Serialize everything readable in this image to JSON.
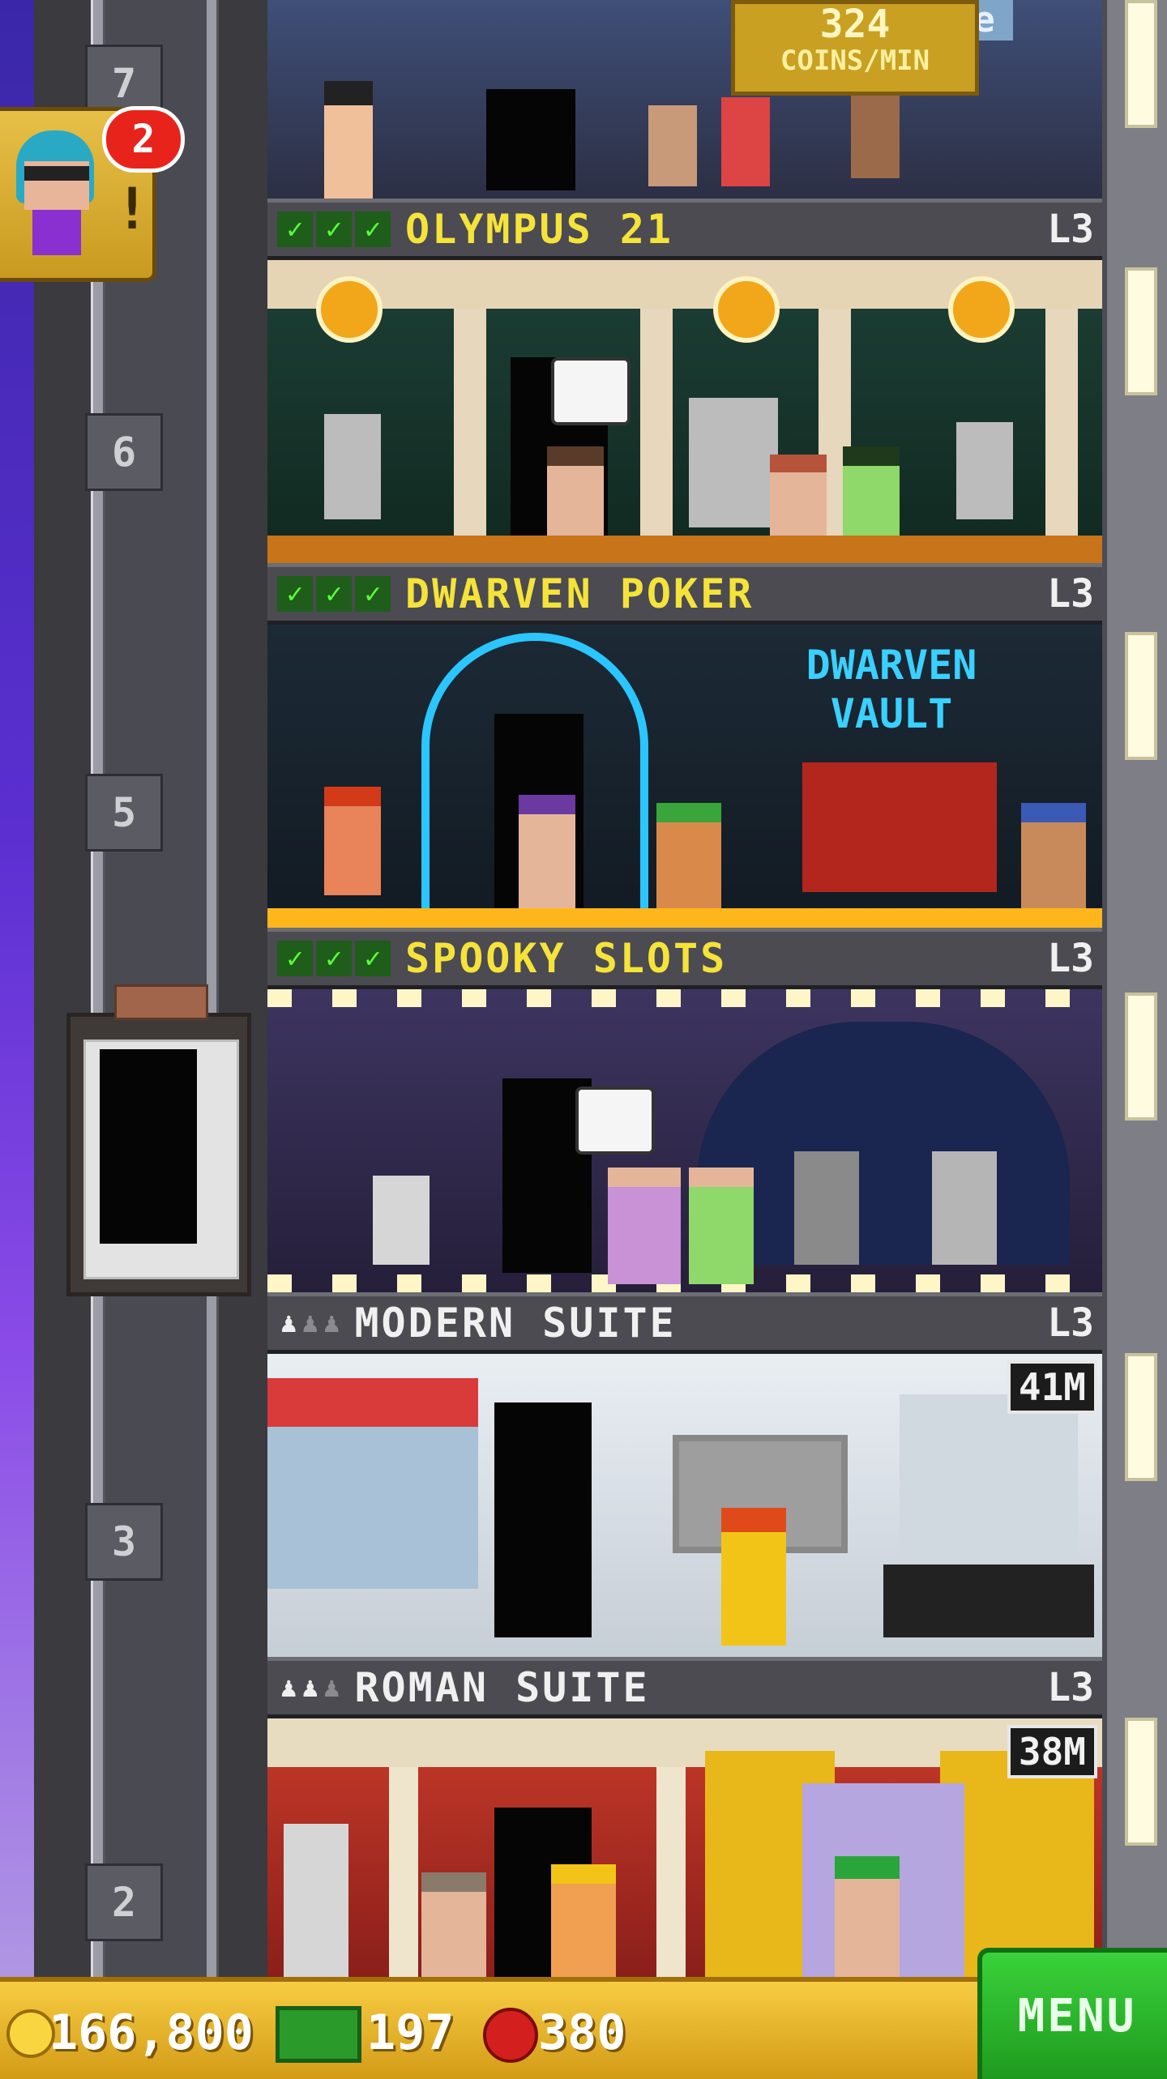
{
  "top_sign": {
    "rate": "324",
    "unit": "COINS/MIN",
    "restaurant_word": "Cuisine"
  },
  "notification": {
    "count": "2"
  },
  "floors": [
    {
      "kind": "business",
      "name": "OLYMPUS 21",
      "level": "L3",
      "stars": 3
    },
    {
      "kind": "business",
      "name": "DWARVEN POKER",
      "level": "L3",
      "stars": 3,
      "sign": "DWARVEN VAULT"
    },
    {
      "kind": "business",
      "name": "SPOOKY SLOTS",
      "level": "L3",
      "stars": 3
    },
    {
      "kind": "residence",
      "name": "MODERN SUITE",
      "level": "L3",
      "residents": 1,
      "price": "41M"
    },
    {
      "kind": "residence",
      "name": "ROMAN SUITE",
      "level": "L3",
      "residents": 2,
      "price": "38M"
    }
  ],
  "elevator": {
    "floor_numbers": [
      "7",
      "6",
      "5",
      "3",
      "2"
    ]
  },
  "hud": {
    "coins": "166,800",
    "bux": "197",
    "gems": "380",
    "menu_label": "MENU"
  },
  "icons": [
    "check-icon",
    "person-icon",
    "coin-icon",
    "bux-icon",
    "gem-icon",
    "alert-icon"
  ],
  "colors": {
    "business_label": "#f5e33a",
    "residence_label": "#f0f0f0",
    "menu": "#2fbf2f",
    "hud": "#f2c23c"
  }
}
